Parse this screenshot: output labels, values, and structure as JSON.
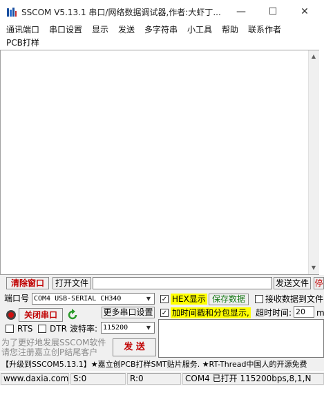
{
  "window": {
    "title": "SSCOM V5.13.1 串口/网络数据调试器,作者:大虾丁...",
    "minimize_glyph": "—",
    "maximize_glyph": "☐",
    "close_glyph": "✕"
  },
  "menu": [
    "通讯端口",
    "串口设置",
    "显示",
    "发送",
    "多字符串",
    "小工具",
    "帮助",
    "联系作者",
    "PCB打样"
  ],
  "toolbar": {
    "clear_label": "清除窗口",
    "open_file_label": "打开文件",
    "file_path": "",
    "send_file_label": "发送文件",
    "cut_label": "停"
  },
  "port": {
    "port_label": "端口号",
    "port_value": "COM4 USB-SERIAL CH340",
    "close_port_label": "关闭串口",
    "more_settings_label": "更多串口设置",
    "rts_label": "RTS",
    "dtr_label": "DTR",
    "baud_label": "波特率:",
    "baud_value": "115200"
  },
  "options": {
    "hex_display_label": "HEX显示",
    "hex_display_checked": true,
    "save_data_label": "保存数据",
    "recv_to_file_label": "接收数据到文件",
    "recv_to_file_checked": false,
    "timestamp_label": "加时间戳和分包显示,",
    "timestamp_checked": true,
    "timeout_label": "超时时间:",
    "timeout_value": "20",
    "timeout_unit": "m"
  },
  "promo": {
    "line1": "为了更好地发展SSCOM软件",
    "line2": "请您注册嘉立创P结尾客户",
    "send_label": "发 送",
    "ticker": "【升级到SSCOM5.13.1】★嘉立创PCB打样SMT贴片服务. ★RT-Thread中国人的开源免费"
  },
  "status": {
    "website": "www.daxia.com",
    "sent": "S:0",
    "received": "R:0",
    "port_status": "COM4 已打开  115200bps,8,1,N"
  },
  "colors": {
    "red_text": "#c00000",
    "highlight": "#ffff00",
    "promo_text": "#8a8a8a"
  }
}
